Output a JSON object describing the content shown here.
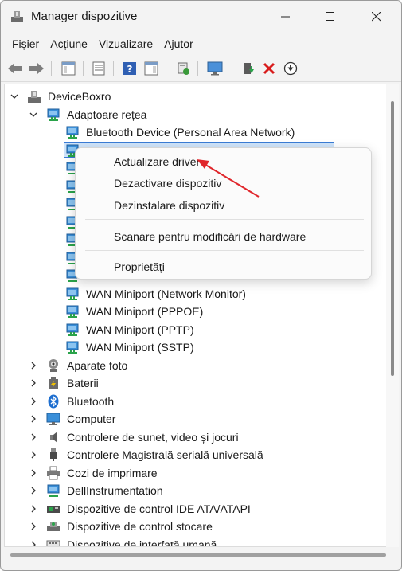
{
  "window": {
    "title": "Manager dispozitive",
    "controls": [
      "minimize",
      "maximize",
      "close"
    ]
  },
  "menubar": {
    "items": [
      "Fișier",
      "Acțiune",
      "Vizualizare",
      "Ajutor"
    ]
  },
  "toolbar": {
    "icons": [
      "back-icon",
      "forward-icon",
      "properties-pane-icon",
      "device-list-icon",
      "help-icon",
      "action-pane-icon",
      "scan-hardware-icon",
      "monitor-icon",
      "update-driver-icon",
      "uninstall-icon",
      "disable-icon"
    ]
  },
  "tree": {
    "root": "DeviceBoxro",
    "adapters_category": "Adaptoare rețea",
    "adapters": [
      "Bluetooth Device (Personal Area Network)",
      "Realtek 8821CE Wireless LAN 802.11ac PCI-E NIC",
      "",
      "",
      "",
      "",
      "",
      "",
      "WAN Miniport (Network Monitor)",
      "WAN Miniport (PPPOE)",
      "WAN Miniport (PPTP)",
      "WAN Miniport (SSTP)"
    ],
    "categories": [
      "Aparate foto",
      "Baterii",
      "Bluetooth",
      "Computer",
      "Controlere de sunet, video și jocuri",
      "Controlere Magistrală serială universală",
      "Cozi de imprimare",
      "DellInstrumentation",
      "Dispozitive de control IDE ATA/ATAPI",
      "Dispozitive de control stocare",
      "Dispozitive de interfață umană"
    ]
  },
  "context_menu": {
    "items": [
      "Actualizare driver",
      "Dezactivare dispozitiv",
      "Dezinstalare dispozitiv",
      "Scanare pentru modificări de hardware",
      "Proprietăți"
    ]
  },
  "colors": {
    "accent": "#3a7bd5",
    "selection": "#cfe4fa",
    "annotation_arrow": "#e0262b",
    "disable_red": "#d81b1b"
  }
}
